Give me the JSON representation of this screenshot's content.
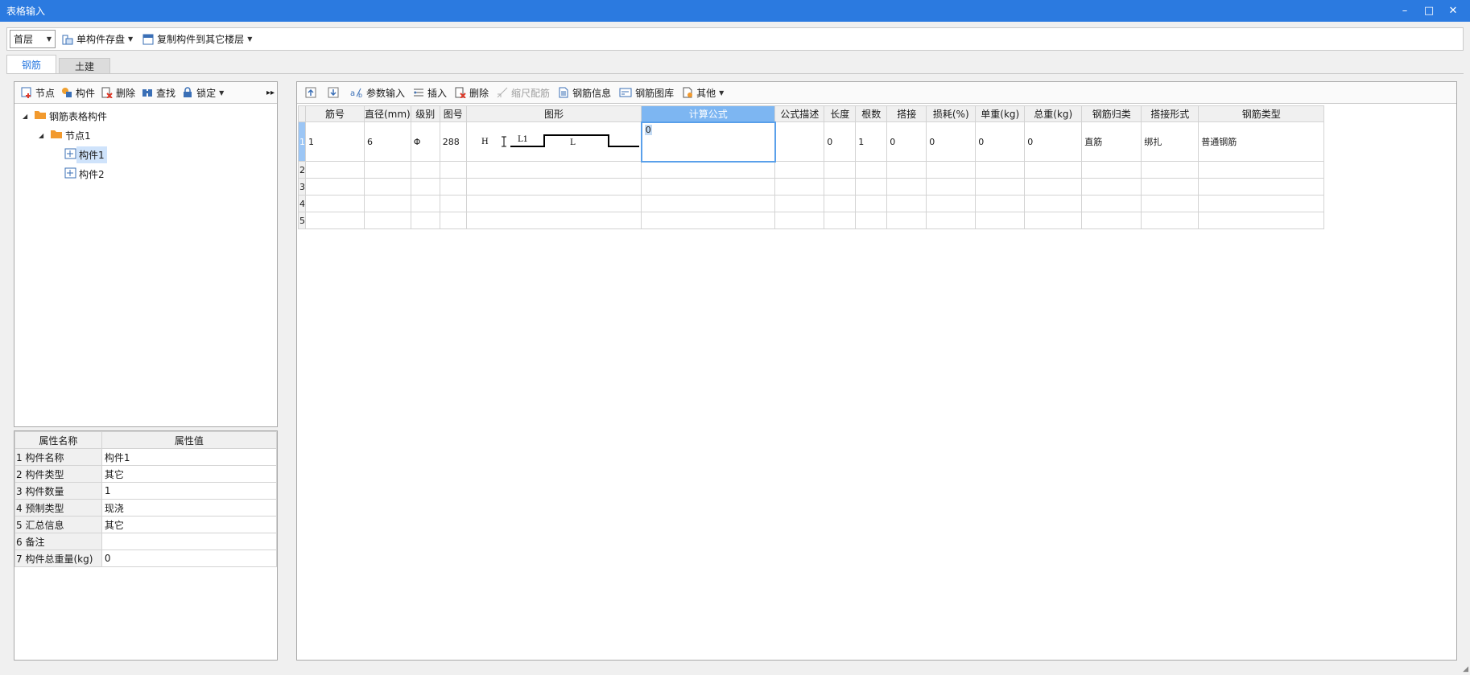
{
  "window": {
    "title": "表格输入",
    "min": "–",
    "max": "□",
    "close": "✕"
  },
  "topbar": {
    "floor": "首层",
    "save_label": "单构件存盘",
    "copy_label": "复制构件到其它楼层"
  },
  "tabs": [
    "钢筋",
    "土建"
  ],
  "left_toolbar": {
    "node": "节点",
    "component": "构件",
    "delete": "删除",
    "find": "查找",
    "lock": "锁定",
    "more": "▸▸"
  },
  "tree": {
    "root": "钢筋表格构件",
    "node": "节点1",
    "items": [
      "构件1",
      "构件2"
    ]
  },
  "props": {
    "headers": [
      "属性名称",
      "属性值"
    ],
    "rows": [
      {
        "n": "1",
        "name": "构件名称",
        "value": "构件1"
      },
      {
        "n": "2",
        "name": "构件类型",
        "value": "其它"
      },
      {
        "n": "3",
        "name": "构件数量",
        "value": "1"
      },
      {
        "n": "4",
        "name": "预制类型",
        "value": "现浇"
      },
      {
        "n": "5",
        "name": "汇总信息",
        "value": "其它"
      },
      {
        "n": "6",
        "name": "备注",
        "value": ""
      },
      {
        "n": "7",
        "name": "构件总重量(kg)",
        "value": "0"
      }
    ]
  },
  "right_toolbar": {
    "param_input": "参数输入",
    "insert": "插入",
    "delete": "删除",
    "scale": "缩尺配筋",
    "rebar_info": "钢筋信息",
    "rebar_library": "钢筋图库",
    "other": "其他"
  },
  "grid": {
    "headers": [
      "筋号",
      "直径(mm)",
      "级别",
      "图号",
      "图形",
      "计算公式",
      "公式描述",
      "长度",
      "根数",
      "搭接",
      "损耗(%)",
      "单重(kg)",
      "总重(kg)",
      "钢筋归类",
      "搭接形式",
      "钢筋类型"
    ],
    "row1": {
      "n": "1",
      "bar_no": "1",
      "diameter": "6",
      "grade": "Φ",
      "fig_no": "288",
      "formula": "0",
      "desc": "",
      "length": "0",
      "count": "1",
      "lap": "0",
      "loss": "0",
      "unit_weight": "0",
      "total_weight": "0",
      "category": "直筋",
      "lap_type": "绑扎",
      "bar_type": "普通钢筋"
    },
    "shape_labels": {
      "h": "H",
      "l1": "L1",
      "l": "L"
    },
    "empty_rows": [
      "2",
      "3",
      "4",
      "5"
    ]
  }
}
